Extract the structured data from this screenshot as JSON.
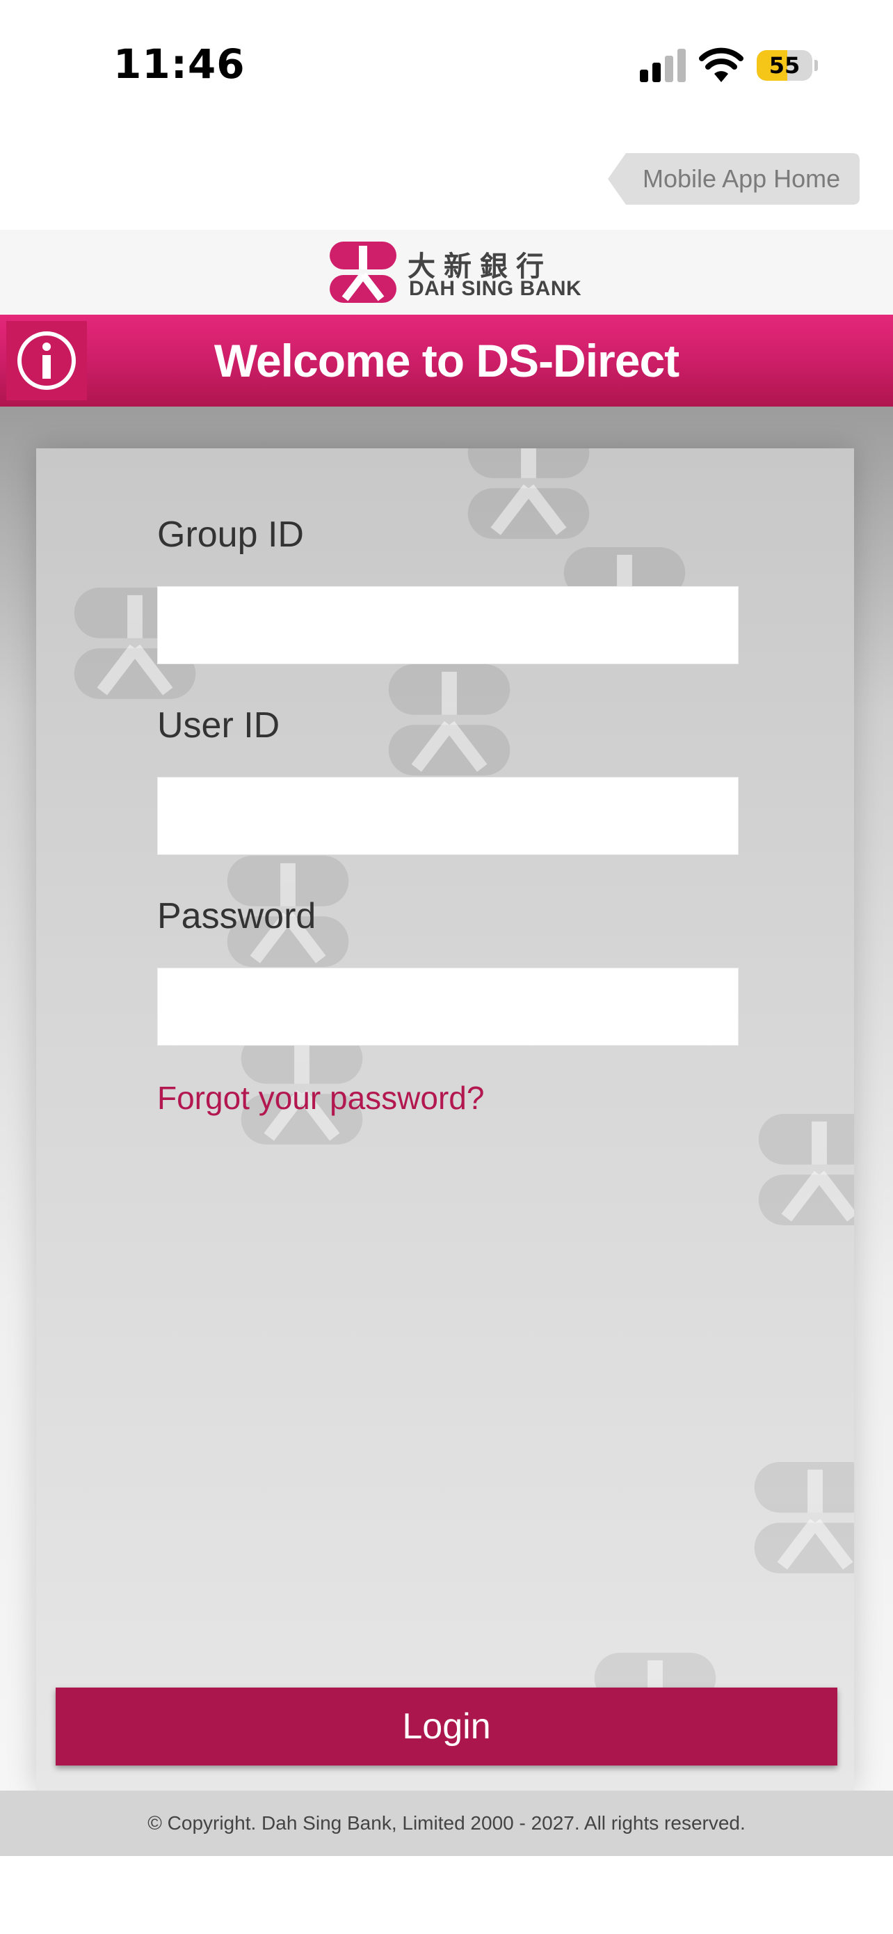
{
  "status_bar": {
    "time": "11:46",
    "battery": "55",
    "battery_level": 0.55
  },
  "nav": {
    "home_button": "Mobile App Home"
  },
  "logo": {
    "chinese_name": "大新銀行",
    "english_name": "DAH SING BANK"
  },
  "header": {
    "title": "Welcome to DS-Direct"
  },
  "form": {
    "group_id_label": "Group ID",
    "group_id_value": "",
    "user_id_label": "User ID",
    "user_id_value": "",
    "password_label": "Password",
    "password_value": "",
    "forgot_link": "Forgot your password?",
    "login_button": "Login"
  },
  "footer": {
    "copyright": "© Copyright. Dah Sing Bank, Limited 2000 - 2027. All rights reserved."
  },
  "colors": {
    "brand_magenta": "#d01f6a",
    "button": "#ab164c",
    "link": "#b3174f",
    "battery_fill": "#f5c518"
  }
}
